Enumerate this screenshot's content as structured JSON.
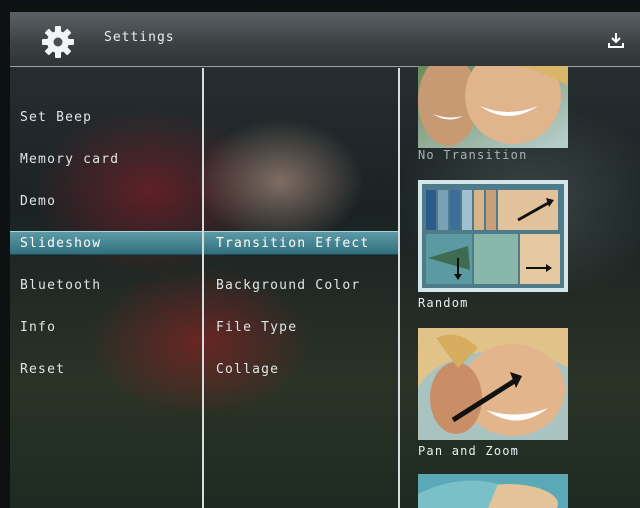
{
  "header": {
    "title": "Settings",
    "gear_icon": "gear-icon",
    "download_icon": "download-icon"
  },
  "menu1": [
    {
      "label": "Set Beep",
      "selected": false
    },
    {
      "label": "Memory card",
      "selected": false
    },
    {
      "label": "Demo",
      "selected": false
    },
    {
      "label": "Slideshow",
      "selected": true
    },
    {
      "label": "Bluetooth",
      "selected": false
    },
    {
      "label": "Info",
      "selected": false
    },
    {
      "label": "Reset",
      "selected": false
    }
  ],
  "menu2": [
    {
      "label": "Transition Effect",
      "selected": true
    },
    {
      "label": "Background Color",
      "selected": false
    },
    {
      "label": "File Type",
      "selected": false
    },
    {
      "label": "Collage",
      "selected": false
    }
  ],
  "transitions": [
    {
      "label": "No Transition",
      "selected": false
    },
    {
      "label": "Random",
      "selected": true
    },
    {
      "label": "Pan and Zoom",
      "selected": false
    }
  ],
  "colors": {
    "accent": "#2f6f7c",
    "header": "#3b4043",
    "text": "#dfe5e6"
  }
}
